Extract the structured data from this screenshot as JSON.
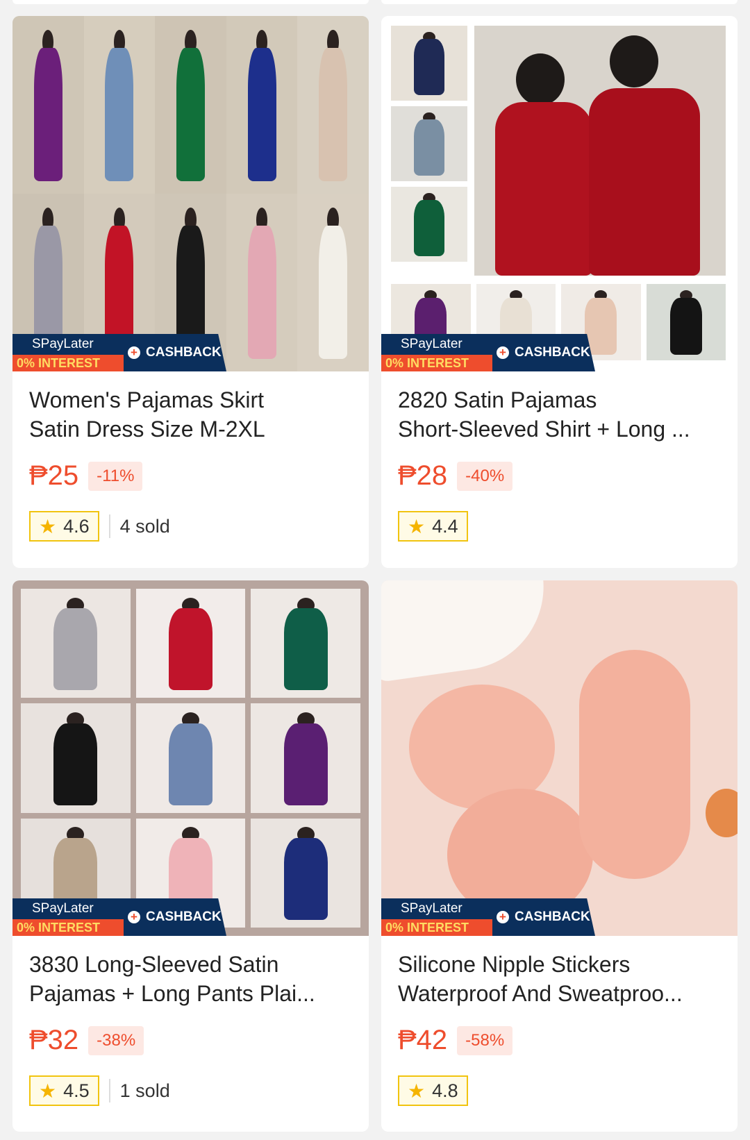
{
  "badge": {
    "spaylater": "SPayLater",
    "interest": "0% INTEREST",
    "cashback": "CASHBACK"
  },
  "products": [
    {
      "title_line1": "Women's Pajamas Skirt",
      "title_line2": "Satin Dress Size M-2XL",
      "price": "₱25",
      "discount": "-11%",
      "rating": "4.6",
      "sold": "4 sold"
    },
    {
      "title_line1": "2820 Satin Pajamas",
      "title_line2": "Short-Sleeved Shirt + Long ...",
      "price": "₱28",
      "discount": "-40%",
      "rating": "4.4",
      "sold": ""
    },
    {
      "title_line1": "3830 Long-Sleeved Satin",
      "title_line2": "Pajamas + Long Pants Plai...",
      "price": "₱32",
      "discount": "-38%",
      "rating": "4.5",
      "sold": "1 sold"
    },
    {
      "title_line1": "Silicone Nipple Stickers",
      "title_line2": "Waterproof And Sweatproo...",
      "price": "₱42",
      "discount": "-58%",
      "rating": "4.8",
      "sold": ""
    }
  ],
  "icons": {
    "star": "star-icon",
    "plus": "plus-circle-icon"
  },
  "colors": {
    "accent": "#ee4d2d",
    "badge_navy": "#0b2f5c",
    "rating_border": "#f1c40f"
  }
}
